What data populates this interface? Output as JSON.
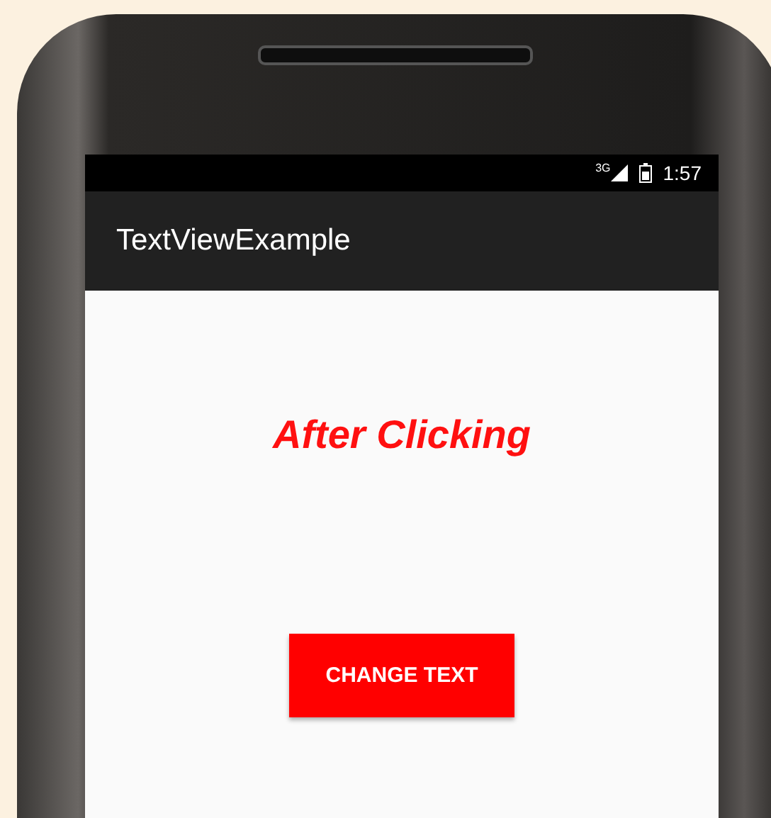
{
  "status_bar": {
    "network": "3G",
    "time": "1:57"
  },
  "app_bar": {
    "title": "TextViewExample"
  },
  "content": {
    "text": "After Clicking",
    "button": "CHANGE TEXT"
  }
}
